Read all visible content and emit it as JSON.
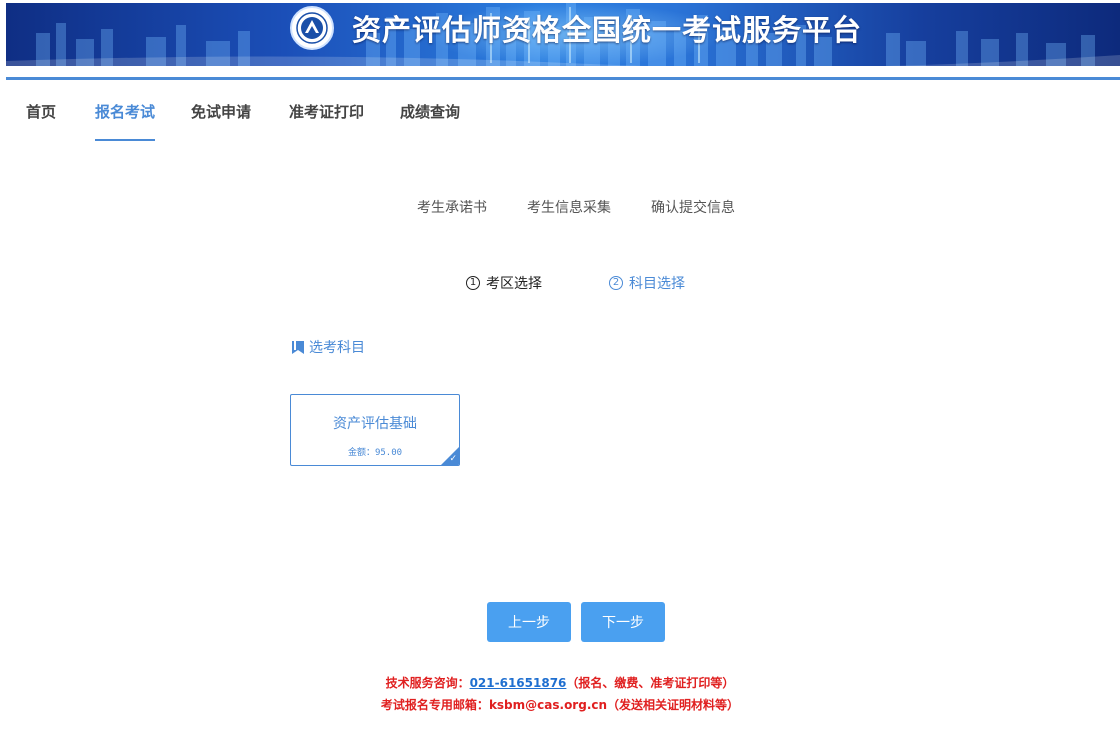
{
  "header": {
    "title": "资产评估师资格全国统一考试服务平台"
  },
  "nav": {
    "items": [
      {
        "label": "首页"
      },
      {
        "label": "报名考试"
      },
      {
        "label": "免试申请"
      },
      {
        "label": "准考证打印"
      },
      {
        "label": "成绩查询"
      }
    ],
    "active": "报名考试"
  },
  "steps": [
    {
      "label": "考生承诺书"
    },
    {
      "label": "考生信息采集"
    },
    {
      "label": "确认提交信息"
    }
  ],
  "substeps": [
    {
      "num": "1",
      "label": "考区选择"
    },
    {
      "num": "2",
      "label": "科目选择"
    }
  ],
  "section": {
    "title": "选考科目"
  },
  "subject": {
    "name": "资产评估基础",
    "fee": "金额：95.00",
    "selected": true
  },
  "buttons": {
    "prev": "上一步",
    "next": "下一步"
  },
  "footer": {
    "line1_prefix": "技术服务咨询：",
    "line1_phone": "021-61651876",
    "line1_suffix": "（报名、缴费、准考证打印等）",
    "line2_prefix": "考试报名专用邮箱：",
    "line2_email": "ksbm@cas.org.cn",
    "line2_suffix": "（发送相关证明材料等）"
  },
  "colors": {
    "accent": "#4a8ad6",
    "button": "#4aa0f0",
    "footer_text": "#e02020",
    "link": "#1f6fd0"
  }
}
